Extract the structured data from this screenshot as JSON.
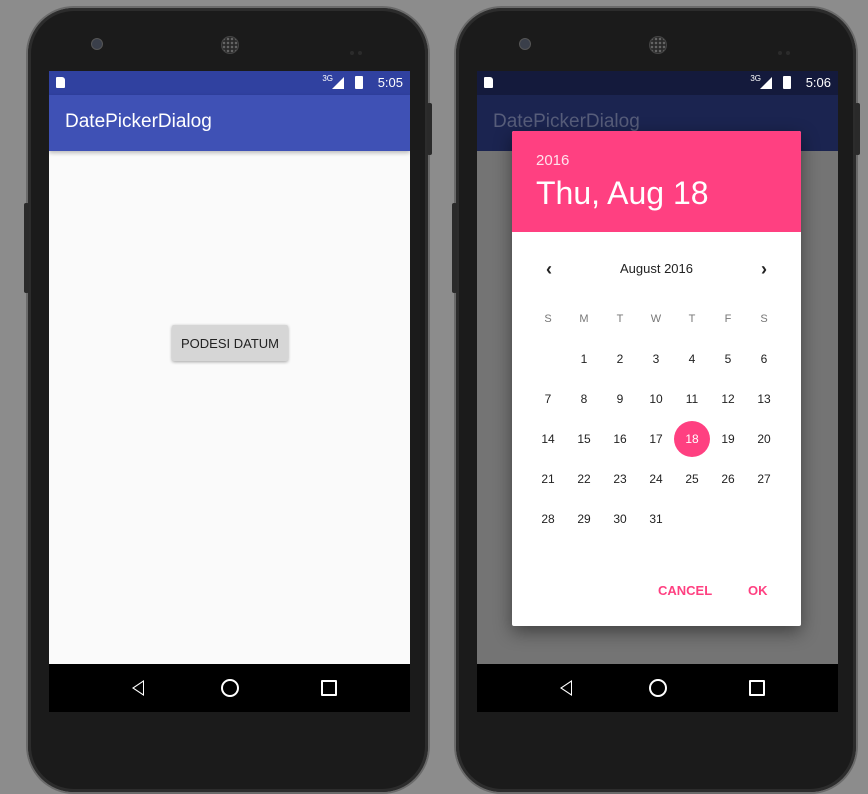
{
  "left_phone": {
    "status": {
      "signal": "3G",
      "time": "5:05"
    },
    "app_title": "DatePickerDialog",
    "button_label": "PODESI DATUM"
  },
  "right_phone": {
    "status": {
      "signal": "3G",
      "time": "5:06"
    },
    "app_title": "DatePickerDialog",
    "dialog": {
      "year": "2016",
      "selected_date": "Thu, Aug 18",
      "month_label": "August 2016",
      "weekdays": [
        "S",
        "M",
        "T",
        "W",
        "T",
        "F",
        "S"
      ],
      "weeks": [
        [
          "",
          "1",
          "2",
          "3",
          "4",
          "5",
          "6"
        ],
        [
          "7",
          "8",
          "9",
          "10",
          "11",
          "12",
          "13"
        ],
        [
          "14",
          "15",
          "16",
          "17",
          "18",
          "19",
          "20"
        ],
        [
          "21",
          "22",
          "23",
          "24",
          "25",
          "26",
          "27"
        ],
        [
          "28",
          "29",
          "30",
          "31",
          "",
          "",
          ""
        ]
      ],
      "selected_day": "18",
      "cancel_label": "CANCEL",
      "ok_label": "OK"
    }
  },
  "colors": {
    "primary": "#3f51b5",
    "primary_dark": "#3041a0",
    "accent": "#ff4081"
  }
}
